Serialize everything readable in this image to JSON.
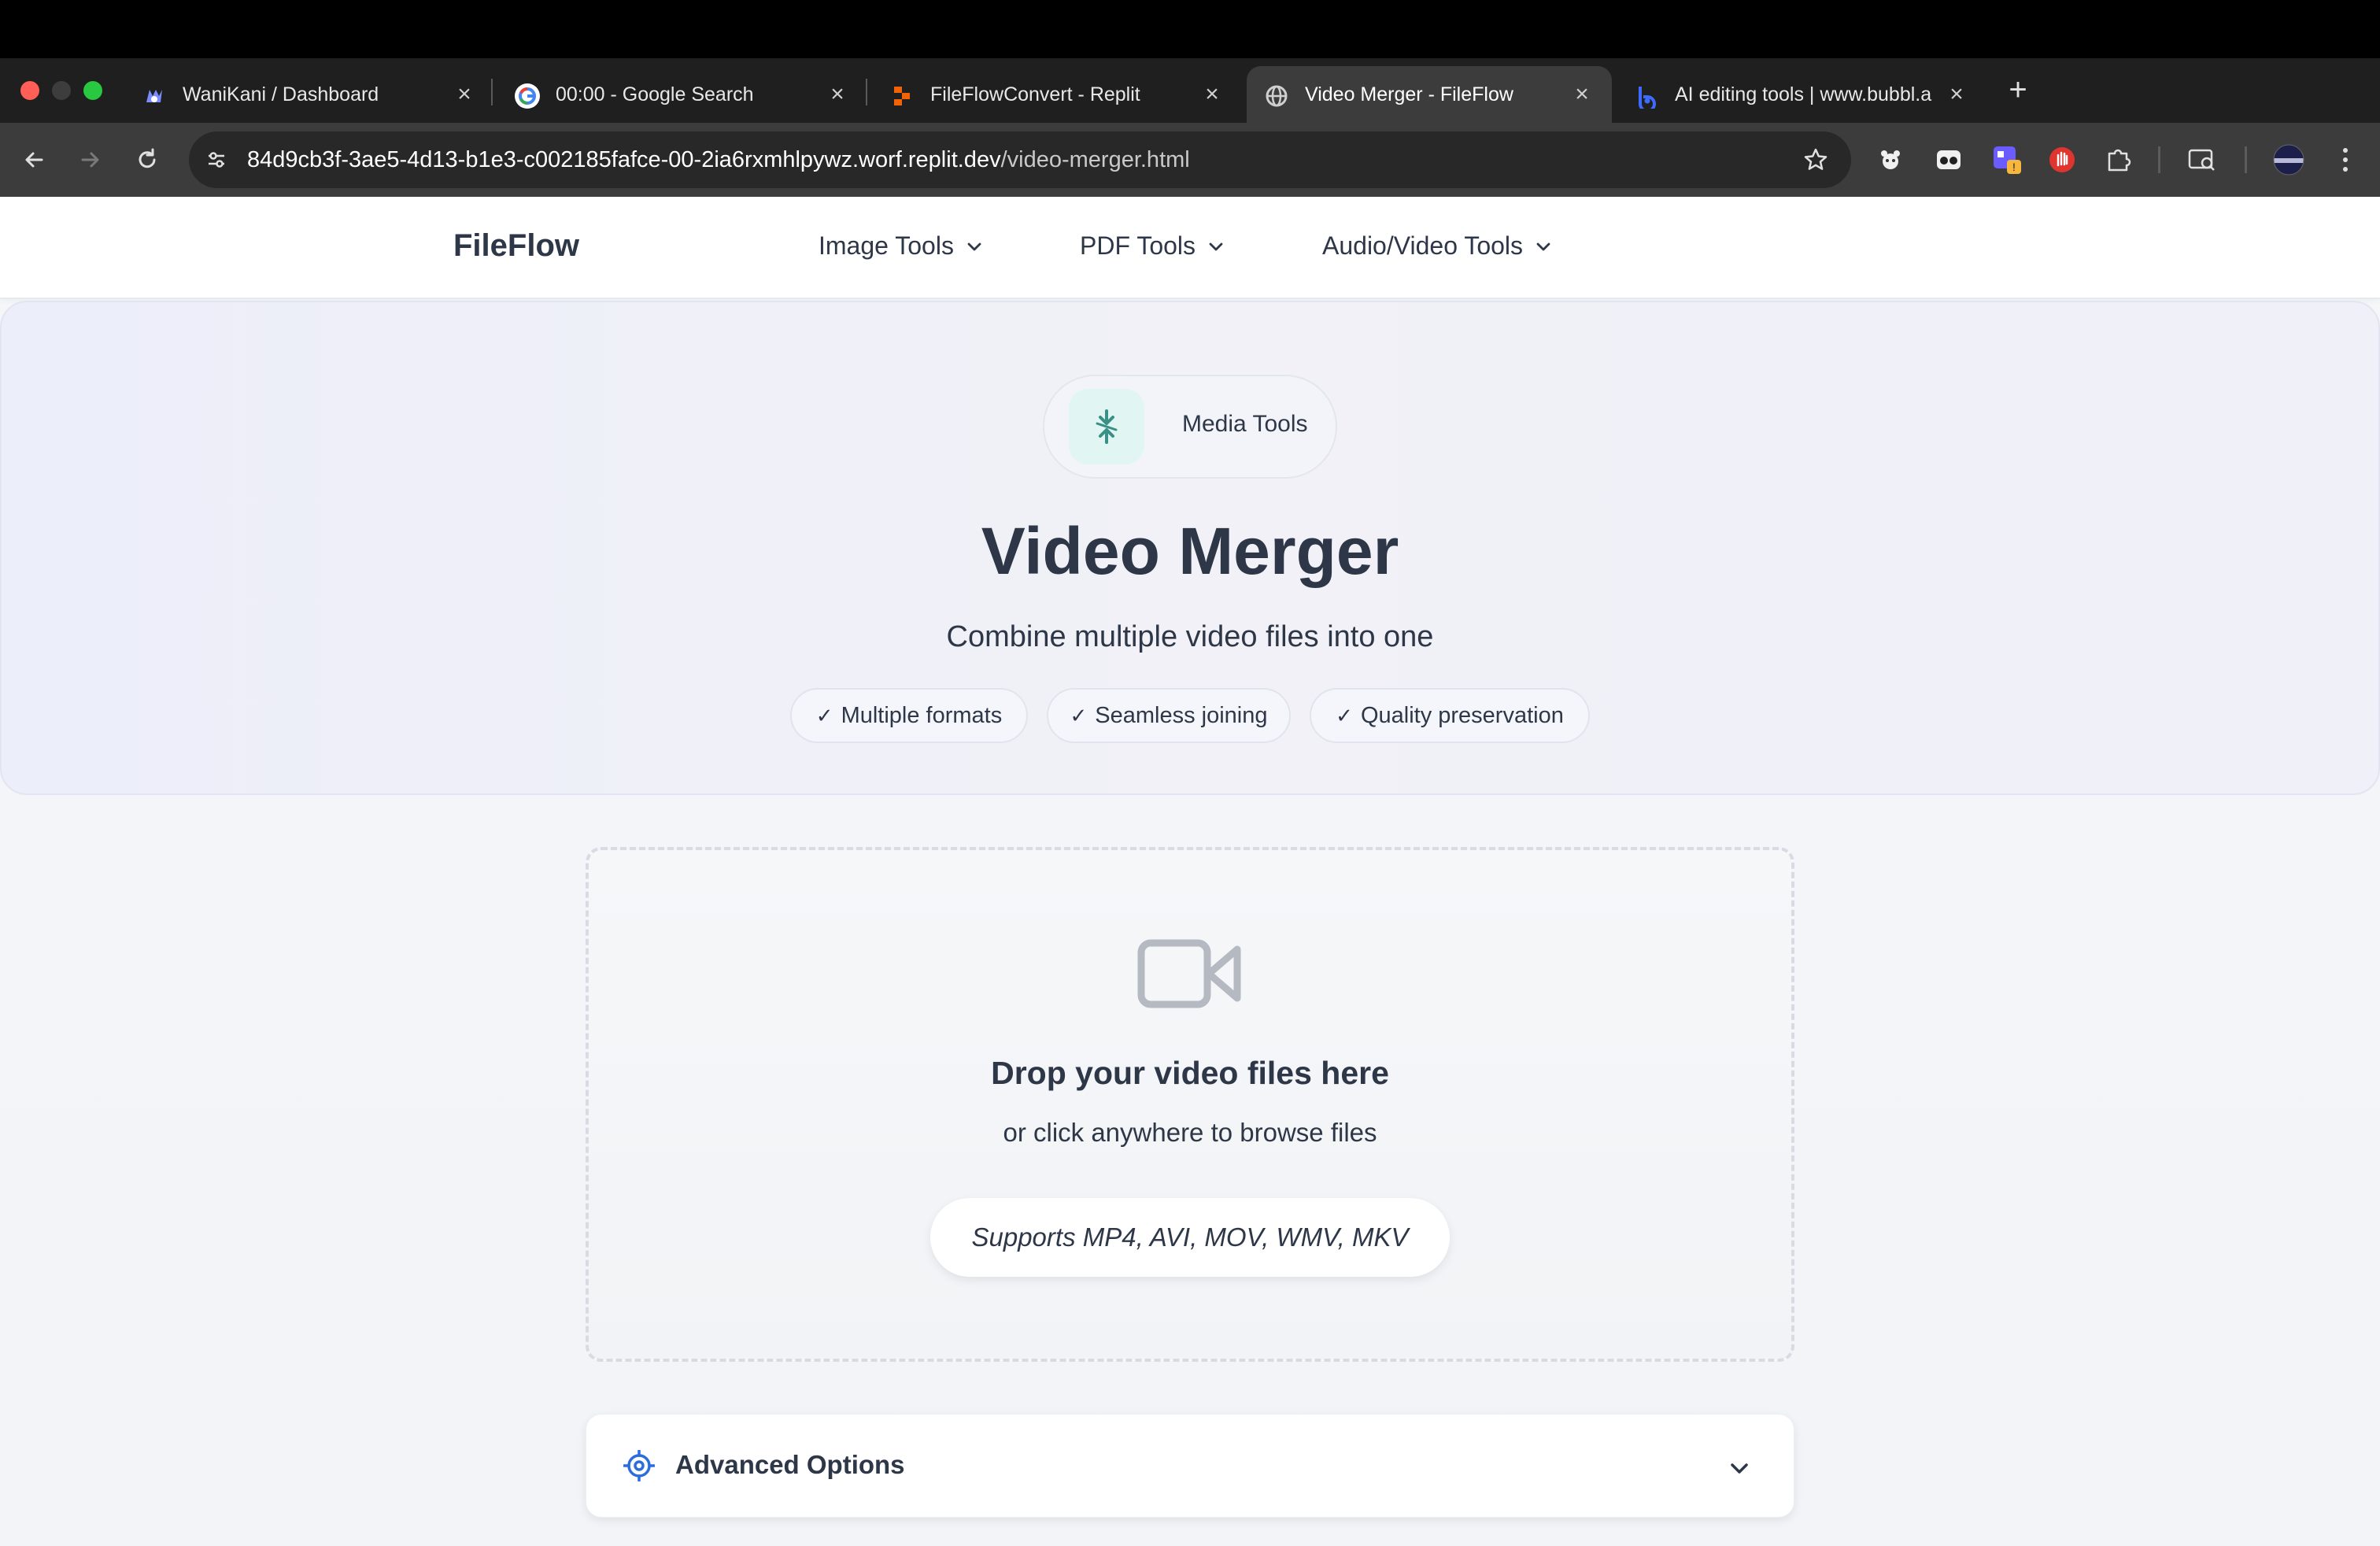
{
  "browser": {
    "tabs": [
      {
        "label": "WaniKani / Dashboard",
        "icon": "wanikani-icon",
        "active": false
      },
      {
        "label": "00:00 - Google Search",
        "icon": "google-icon",
        "active": false
      },
      {
        "label": "FileFlowConvert - Replit",
        "icon": "replit-icon",
        "active": false
      },
      {
        "label": "Video Merger - FileFlow",
        "icon": "globe-icon",
        "active": true
      },
      {
        "label": "AI editing tools | www.bubbl.a",
        "icon": "bubbl-icon",
        "active": false
      }
    ],
    "close_glyph": "×",
    "new_tab_glyph": "+",
    "url_host": "84d9cb3f-3ae5-4d13-b1e3-c002185fafce-00-2ia6rxmhlpywz.worf.replit.dev",
    "url_path": "/video-merger.html"
  },
  "site": {
    "brand": "FileFlow",
    "nav": [
      {
        "label": "Image Tools"
      },
      {
        "label": "PDF Tools"
      },
      {
        "label": "Audio/Video Tools"
      }
    ]
  },
  "hero": {
    "badge": "Media Tools",
    "title": "Video Merger",
    "subtitle": "Combine multiple video files into one",
    "check_glyph": "✓",
    "features": [
      "Multiple formats",
      "Seamless joining",
      "Quality preservation"
    ]
  },
  "dropzone": {
    "title": "Drop your video files here",
    "subtitle": "or click anywhere to browse files",
    "formats": "Supports MP4, AVI, MOV, WMV, MKV"
  },
  "advanced": {
    "label": "Advanced Options"
  },
  "colors": {
    "text": "#2d3748",
    "accent_blue": "#2b6cde",
    "teal": "#3a8f86",
    "chrome_dark": "#1f1f1f",
    "chrome_toolbar": "#3c3c3c"
  }
}
